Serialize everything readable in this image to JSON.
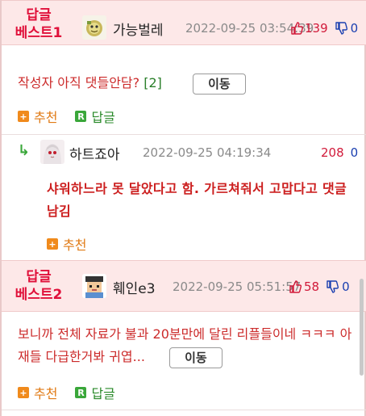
{
  "best1": {
    "label_line1": "답글",
    "label_line2": "베스트1",
    "nickname": "가능벌레",
    "date": "2022-09-25 03:54:39",
    "up_count": "139",
    "down_count": "0",
    "text": "작성자 아직 댓들안담?",
    "reply_count": "[2]",
    "move_label": "이동",
    "recommend_label": "추천",
    "reply_label": "답글"
  },
  "reply1": {
    "nickname": "하트죠아",
    "date": "2022-09-25 04:19:34",
    "up_count": "208",
    "down_count": "0",
    "text": "샤워하느라 못 달았다고 함. 가르쳐줘서 고맙다고 댓글 남김",
    "recommend_label": "추천"
  },
  "best2": {
    "label_line1": "답글",
    "label_line2": "베스트2",
    "nickname": "훼인e3",
    "date": "2022-09-25 05:51:57",
    "up_count": "58",
    "down_count": "0",
    "text": "보니까 전체 자료가 불과 20분만에 달린 리플들이네 ㅋㅋㅋ 아재들 다급한거봐 귀엽...",
    "move_label": "이동",
    "recommend_label": "추천",
    "reply_label": "답글"
  },
  "icons": {
    "thumb_up": "thumb-up-icon",
    "thumb_down": "thumb-down-icon",
    "reply_arrow": "reply-arrow-icon",
    "plus": "plus-icon",
    "r_badge": "r-badge-icon"
  },
  "colors": {
    "best_bg": "#fde8e8",
    "best_label": "#e0103a",
    "content_red": "#cc2b2b",
    "up_red": "#d11a3a",
    "down_blue": "#1a3fb0",
    "accent_orange": "#f08a1c",
    "accent_green": "#3aa73a"
  }
}
